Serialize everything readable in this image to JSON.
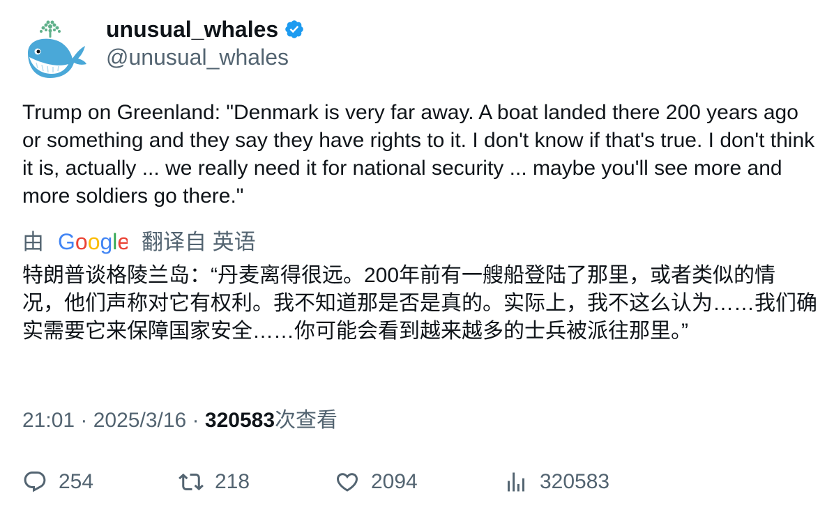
{
  "author": {
    "display_name": "unusual_whales",
    "handle": "@unusual_whales",
    "verified_color": "#1d9bf0",
    "avatar_icon": "whale-avatar"
  },
  "tweet": {
    "text": "Trump on Greenland: \"Denmark is very far away. A boat landed there 200 years ago or something and they say they have rights to it. I don't know if that's true. I don't think it is, actually ... we really need it for national security ... maybe you'll see more and more soldiers go there.\""
  },
  "translation": {
    "prefix": "由",
    "provider": "Google",
    "suffix": "翻译自 英语",
    "text": "特朗普谈格陵兰岛：“丹麦离得很远。200年前有一艘船登陆了那里，或者类似的情况，他们声称对它有权利。我不知道那是否是真的。实际上，我不这么认为……我们确实需要它来保障国家安全……你可能会看到越来越多的士兵被派往那里。”"
  },
  "meta": {
    "time": "21:01",
    "separator": " · ",
    "date": "2025/3/16",
    "views_count": "320583",
    "views_label": "次查看"
  },
  "actions": {
    "replies": "254",
    "retweets": "218",
    "likes": "2094",
    "views": "320583"
  },
  "colors": {
    "text_primary": "#0f1419",
    "text_secondary": "#536471",
    "google_blue": "#4285f4",
    "google_red": "#ea4335",
    "google_yellow": "#fbbc05",
    "google_green": "#34a853"
  }
}
